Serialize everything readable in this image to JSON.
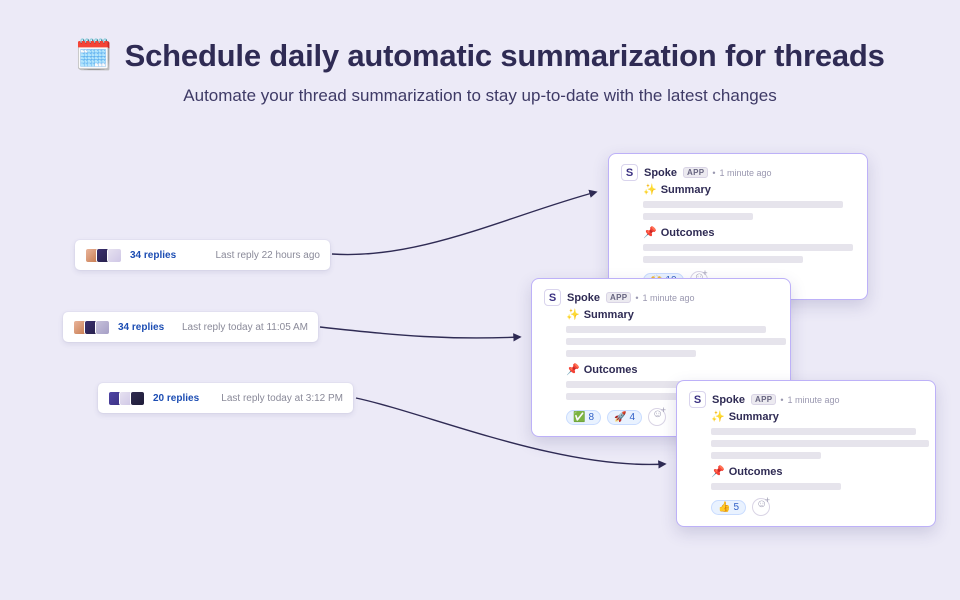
{
  "header": {
    "icon": "🗓️",
    "title": "Schedule daily automatic summarization for threads",
    "subtitle": "Automate your thread summarization to stay up-to-date with the latest changes"
  },
  "threads": [
    {
      "replies": "34 replies",
      "last_reply": "Last reply 22 hours ago"
    },
    {
      "replies": "34 replies",
      "last_reply": "Last reply today at 11:05 AM"
    },
    {
      "replies": "20 replies",
      "last_reply": "Last reply today at 3:12 PM"
    }
  ],
  "summaries": [
    {
      "app_name": "Spoke",
      "badge": "APP",
      "time_sep": "•",
      "time": "1 minute ago",
      "summary_label": "Summary",
      "summary_emoji": "✨",
      "outcomes_label": "Outcomes",
      "outcomes_emoji": "📌",
      "reactions": [
        {
          "emoji": "🙌",
          "count": "10"
        }
      ]
    },
    {
      "app_name": "Spoke",
      "badge": "APP",
      "time_sep": "•",
      "time": "1 minute ago",
      "summary_label": "Summary",
      "summary_emoji": "✨",
      "outcomes_label": "Outcomes",
      "outcomes_emoji": "📌",
      "reactions": [
        {
          "emoji": "✅",
          "count": "8"
        },
        {
          "emoji": "🚀",
          "count": "4"
        }
      ]
    },
    {
      "app_name": "Spoke",
      "badge": "APP",
      "time_sep": "•",
      "time": "1 minute ago",
      "summary_label": "Summary",
      "summary_emoji": "✨",
      "outcomes_label": "Outcomes",
      "outcomes_emoji": "📌",
      "reactions": [
        {
          "emoji": "👍",
          "count": "5"
        }
      ]
    }
  ]
}
